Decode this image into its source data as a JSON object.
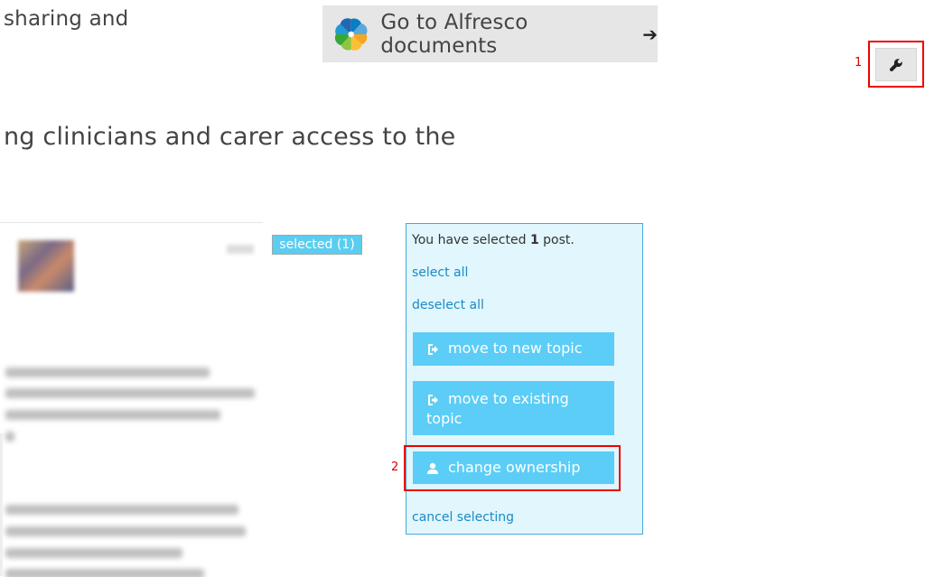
{
  "header": {
    "title_fragment": "sharing and",
    "alfresco_button_label": "Go to Alfresco documents",
    "alfresco_button_arrow": "➔"
  },
  "subtitle_fragment": "ng clinicians and carer access to the",
  "annotations": {
    "marker_1": "1",
    "marker_2": "2"
  },
  "selected_badge": "selected (1)",
  "panel": {
    "info_prefix": "You have selected ",
    "info_count": "1",
    "info_suffix": " post.",
    "select_all": "select all",
    "deselect_all": "deselect all",
    "move_new_topic": "move to new topic",
    "move_existing_topic": "move to existing topic",
    "change_ownership": "change ownership",
    "cancel_selecting": "cancel selecting"
  },
  "icons": {
    "wrench": "wrench-icon",
    "alfresco_logo": "alfresco-logo-icon",
    "sign_in": "sign-in-icon",
    "user": "user-icon"
  },
  "colors": {
    "panel_bg": "#e1f6fd",
    "panel_border": "#45a9d8",
    "button_bg": "#5bcdf7",
    "link": "#1a8bc4",
    "annotation": "#e00000"
  }
}
